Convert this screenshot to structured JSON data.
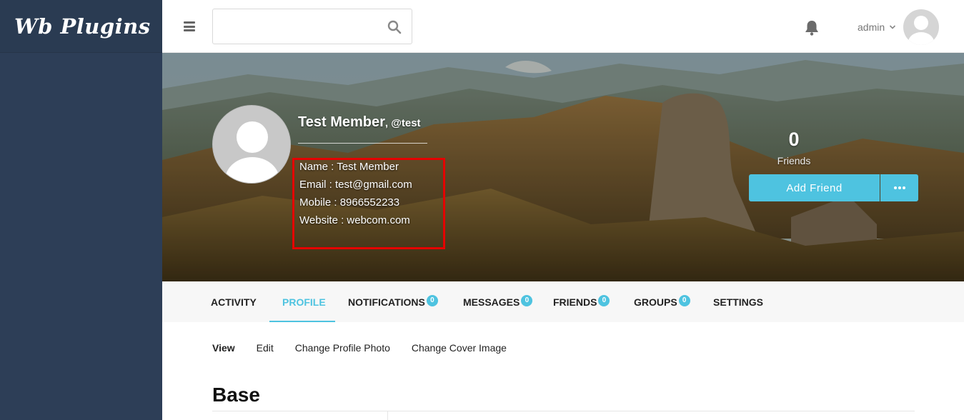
{
  "sidebar": {
    "logo": "Wb Plugins",
    "bg_color": "#2d3e57"
  },
  "header": {
    "search": {
      "placeholder": "",
      "value": ""
    },
    "icons": [
      "menu-icon",
      "search-icon",
      "bell-icon",
      "chevron-down-icon"
    ],
    "user": {
      "name": "admin"
    }
  },
  "profile": {
    "display_name": "Test Member",
    "handle": ", @test",
    "info": [
      {
        "label": "Name : Test Member"
      },
      {
        "label": "Email : test@gmail.com"
      },
      {
        "label": "Mobile : 8966552233"
      },
      {
        "label": "Website : webcom.com"
      }
    ],
    "friends_count": "0",
    "friends_label": "Friends",
    "add_friend_label": "Add Friend",
    "highlight_color": "#e50000"
  },
  "tabs": [
    {
      "label": "ACTIVITY",
      "badge": null,
      "active": false
    },
    {
      "label": "PROFILE",
      "badge": null,
      "active": true
    },
    {
      "label": "NOTIFICATIONS",
      "badge": "0",
      "active": false
    },
    {
      "label": "MESSAGES",
      "badge": "0",
      "active": false
    },
    {
      "label": "FRIENDS",
      "badge": "0",
      "active": false
    },
    {
      "label": "GROUPS",
      "badge": "0",
      "active": false
    },
    {
      "label": "SETTINGS",
      "badge": null,
      "active": false
    }
  ],
  "subnav": [
    {
      "label": "View",
      "active": true
    },
    {
      "label": "Edit",
      "active": false
    },
    {
      "label": "Change Profile Photo",
      "active": false
    },
    {
      "label": "Change Cover Image",
      "active": false
    }
  ],
  "section": {
    "title": "Base"
  },
  "colors": {
    "accent": "#4ec3e0",
    "sidebar": "#2d3e57"
  }
}
